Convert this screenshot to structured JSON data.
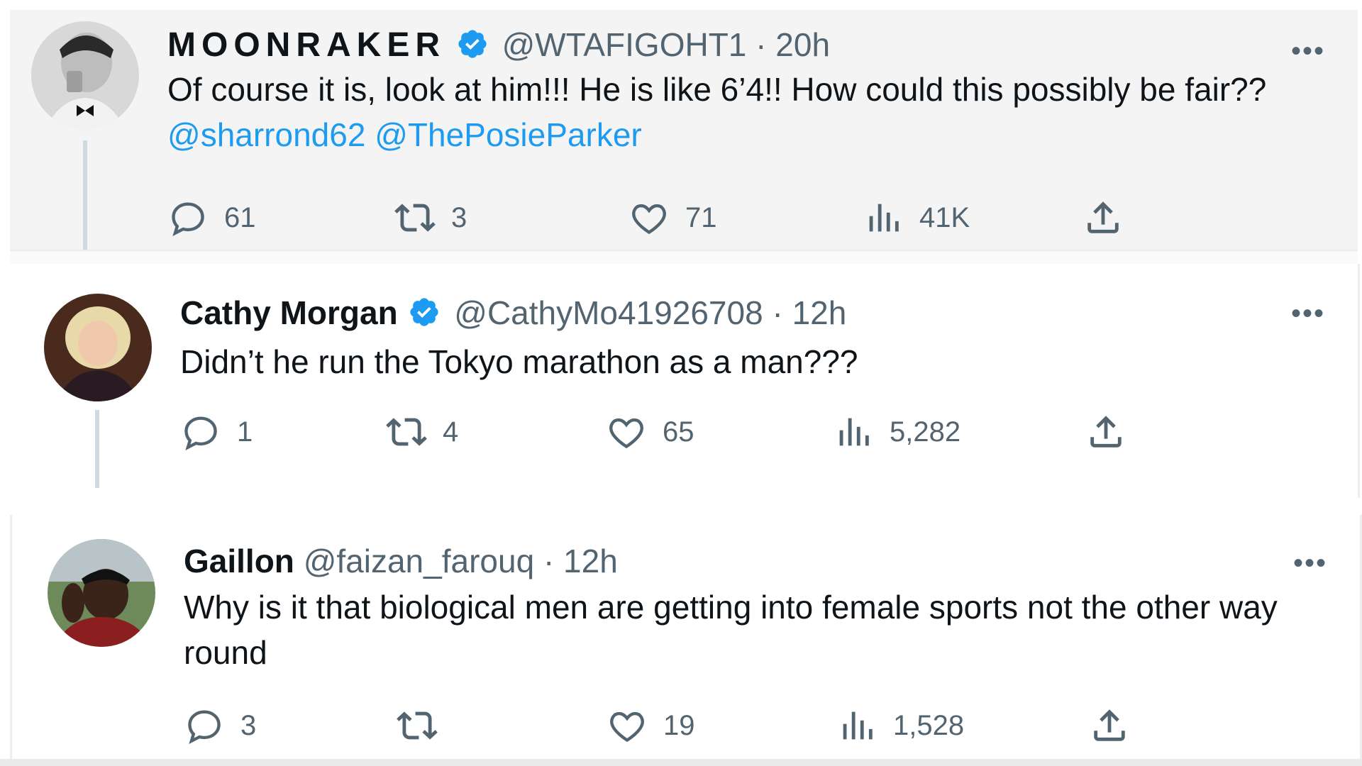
{
  "tweets": [
    {
      "display_name": "MOONRAKER",
      "verified": true,
      "handle": "@WTAFIGOHT1",
      "time": "20h",
      "text": "Of course it is, look at him!!! He is like 6’4!! How could this possibly be fair??",
      "mentions": [
        "@sharrond62",
        "@ThePosieParker"
      ],
      "replies": "61",
      "retweets": "3",
      "likes": "71",
      "views": "41K"
    },
    {
      "display_name": "Cathy Morgan",
      "verified": true,
      "handle": "@CathyMo41926708",
      "time": "12h",
      "text": "Didn’t he run the Tokyo marathon as a man???",
      "replies": "1",
      "retweets": "4",
      "likes": "65",
      "views": "5,282"
    },
    {
      "display_name": "Gaillon",
      "verified": false,
      "handle": "@faizan_farouq",
      "time": "12h",
      "text": "Why is it that biological men are getting into female sports not the other way round",
      "replies": "3",
      "retweets": "",
      "likes": "19",
      "views": "1,528"
    }
  ],
  "ui": {
    "separator": "·",
    "more_glyph": "•••"
  },
  "icons": {
    "reply": "reply-icon",
    "retweet": "retweet-icon",
    "like": "heart-icon",
    "views": "views-icon",
    "share": "share-icon",
    "verified": "verified-badge-icon",
    "more": "more-options-icon"
  },
  "colors": {
    "mention": "#1d9bf0",
    "verified": "#1d9bf0",
    "muted_text": "#536471",
    "primary_text": "#0f1419"
  }
}
